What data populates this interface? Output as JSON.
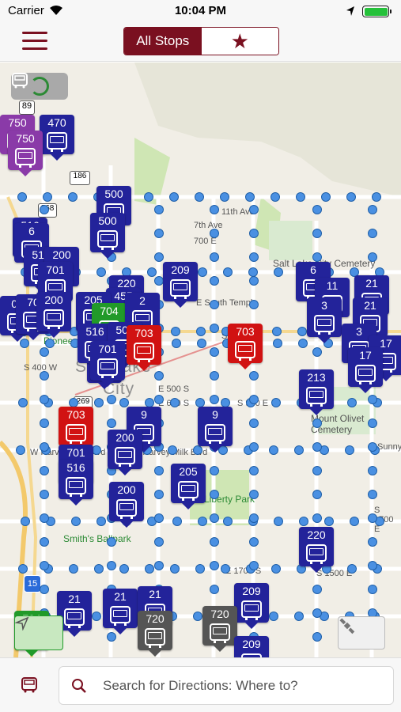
{
  "status": {
    "carrier": "Carrier",
    "time": "10:04 PM"
  },
  "nav": {
    "segments": [
      "All Stops",
      "★"
    ]
  },
  "map": {
    "city_label_1": "Salt Lake",
    "city_label_2": "City",
    "places": [
      "Smith's Ballpark",
      "Salt Lake City Cemetery",
      "Mount Olivet Cemetery",
      "Liberty Park",
      "Pioneer Park"
    ],
    "streets": [
      "E South Temple",
      "E 500 S",
      "E 600 S",
      "E 1700 S",
      "W Harvey Milk Blvd",
      "E Harvey Milk Blvd",
      "S 1500 E",
      "S 1700 E",
      "S 900 E",
      "S 500 E",
      "700 E",
      "7th Ave",
      "11th Ave",
      "Sunnyside",
      "S 400 W"
    ],
    "routes": [
      "89",
      "186",
      "268",
      "269",
      "15"
    ],
    "vehicles": [
      {
        "route": "750",
        "color": "purple"
      },
      {
        "route": "470",
        "color": "blue"
      },
      {
        "route": "750",
        "color": "purple"
      },
      {
        "route": "500",
        "color": "blue"
      },
      {
        "route": "500",
        "color": "blue"
      },
      {
        "route": "516",
        "color": "blue"
      },
      {
        "route": "6",
        "color": "blue"
      },
      {
        "route": "519",
        "color": "blue"
      },
      {
        "route": "200",
        "color": "blue"
      },
      {
        "route": "701",
        "color": "blue"
      },
      {
        "route": "220",
        "color": "blue"
      },
      {
        "route": "455",
        "color": "blue"
      },
      {
        "route": "209",
        "color": "blue"
      },
      {
        "route": "05",
        "color": "blue"
      },
      {
        "route": "70",
        "color": "blue"
      },
      {
        "route": "200",
        "color": "blue"
      },
      {
        "route": "205",
        "color": "blue"
      },
      {
        "route": "704",
        "color": "green"
      },
      {
        "route": "2",
        "color": "blue"
      },
      {
        "route": "701",
        "color": "blue"
      },
      {
        "route": "516",
        "color": "blue"
      },
      {
        "route": "500",
        "color": "blue"
      },
      {
        "route": "703",
        "color": "red"
      },
      {
        "route": "701",
        "color": "blue"
      },
      {
        "route": "703",
        "color": "red"
      },
      {
        "route": "6",
        "color": "blue"
      },
      {
        "route": "11",
        "color": "blue"
      },
      {
        "route": "21",
        "color": "blue"
      },
      {
        "route": "3",
        "color": "blue"
      },
      {
        "route": "21",
        "color": "blue"
      },
      {
        "route": "3",
        "color": "blue"
      },
      {
        "route": "17",
        "color": "blue"
      },
      {
        "route": "17",
        "color": "blue"
      },
      {
        "route": "213",
        "color": "blue"
      },
      {
        "route": "703",
        "color": "red"
      },
      {
        "route": "9",
        "color": "blue"
      },
      {
        "route": "9",
        "color": "blue"
      },
      {
        "route": "200",
        "color": "blue"
      },
      {
        "route": "701",
        "color": "blue"
      },
      {
        "route": "516",
        "color": "blue"
      },
      {
        "route": "205",
        "color": "blue"
      },
      {
        "route": "200",
        "color": "blue"
      },
      {
        "route": "220",
        "color": "blue"
      },
      {
        "route": "21",
        "color": "blue"
      },
      {
        "route": "21",
        "color": "blue"
      },
      {
        "route": "21",
        "color": "blue"
      },
      {
        "route": "209",
        "color": "blue"
      },
      {
        "route": "720",
        "color": "gray"
      },
      {
        "route": "720",
        "color": "gray"
      },
      {
        "route": "209",
        "color": "blue"
      },
      {
        "route": "704",
        "color": "green"
      }
    ]
  },
  "bottom": {
    "search_placeholder": "Search for Directions: Where to?"
  },
  "colors": {
    "accent": "#7a1020",
    "bus": "#23239a",
    "trax_red": "#d11212",
    "trax_green": "#219a29",
    "frontrunner": "#8a3aa8",
    "stop": "#4a90e2"
  }
}
